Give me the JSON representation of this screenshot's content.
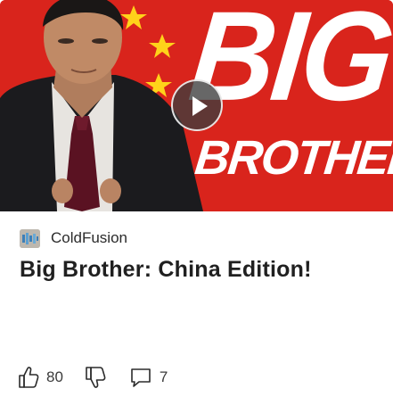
{
  "card": {
    "thumbnail": {
      "title_line1": "BIG",
      "title_line2": "BROTHER",
      "background_color": "#d9241c",
      "play_icon": "play-icon"
    },
    "source": {
      "name": "ColdFusion",
      "logo_icon": "coldfusion-logo"
    },
    "headline": "Big Brother: China Edition!",
    "actions": {
      "like_icon": "thumbs-up-icon",
      "like_count": "80",
      "dislike_icon": "thumbs-down-icon",
      "comment_icon": "comment-icon",
      "comment_count": "7"
    }
  }
}
